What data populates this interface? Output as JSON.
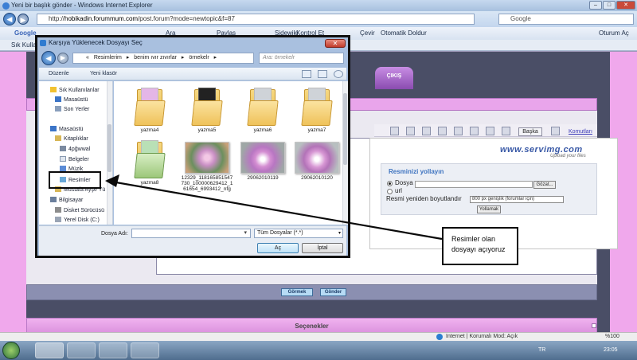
{
  "browser": {
    "title": "Yeni bir başlık gönder - Windows Internet Explorer",
    "url_prefix": "http://",
    "url_host": "hobikadin.forummum.com",
    "url_path": "/post.forum?mode=newtopic&f=87",
    "search_text": "Google",
    "google_toolbar": {
      "logo": "Google",
      "ara": "Ara",
      "paylas": "Paylaş",
      "sidewiki": "Sidewiki",
      "kontrol": "Kontrol Et",
      "cevir": "Çevir",
      "otomatik": "Otomatik Doldur",
      "oturum": "Oturum Aç"
    },
    "favorites_label": "Sık Kullanılanlar"
  },
  "forum": {
    "cikis_label": "ÇIKIŞ",
    "baska_label": "Başka",
    "komutlar_label": "Komutları",
    "gormek_label": "Görmek",
    "gonder_label": "Gönder",
    "secenekler_label": "Seçenekler"
  },
  "servimg": {
    "logo": "www.servimg.com",
    "sub": "Upload your files",
    "title": "Resminizi yollayın",
    "radio_dosya": "Dosya",
    "radio_url": "url",
    "gozat_label": "Gözat...",
    "resize_label": "Resmi yeniden boyutlandır",
    "resize_option": "800 px genişlik (forumlar için)",
    "yollamak_label": "Yollamak"
  },
  "dialog": {
    "title": "Karşıya Yüklenecek Dosyayı Seç",
    "path": [
      "Resimlerim",
      "benim ıvır zıvırlar",
      "örnekelr"
    ],
    "search_placeholder": "Ara: örnekelr",
    "cmd_duzenle": "Düzenle",
    "cmd_yeni_klasor": "Yeni klasör",
    "nav": {
      "favorites": "Sık Kullanılanlar",
      "masaustu": "Masaüstü",
      "son_yerler": "Son Yerler",
      "masaustu2": "Masaüstü",
      "kitapliklar": "Kitaplıklar",
      "apgwwal": "4pğwwal",
      "belgeler": "Belgeler",
      "muzik": "Müzik",
      "resimler": "Resimler",
      "mustafa": "Mustafa Ayşe Yü",
      "bilgisayar": "Bilgisayar",
      "disket": "Disket Sürücüsü",
      "yerel_disk": "Yerel Disk (C:)"
    },
    "files": [
      {
        "name": "yazma4"
      },
      {
        "name": "yazma5"
      },
      {
        "name": "yazma6"
      },
      {
        "name": "yazma7"
      },
      {
        "name": "yazma8"
      },
      {
        "name": "12329_118165851547730_100000629412_161654_6993412_nfg"
      },
      {
        "name": "29062010119"
      },
      {
        "name": "29062010120"
      }
    ],
    "filename_label": "Dosya Adı:",
    "filetype_value": "Tüm Dosyalar (*.*)",
    "open_label": "Aç",
    "cancel_label": "İptal"
  },
  "statusbar": {
    "zone": "Internet | Korumalı Mod: Açık",
    "zoom": "%100"
  },
  "taskbar": {
    "lang": "TR",
    "time": "23:05"
  },
  "annotation": {
    "callout_line1": "Resimler olan",
    "callout_line2": "dosyayı açıyoruz"
  }
}
